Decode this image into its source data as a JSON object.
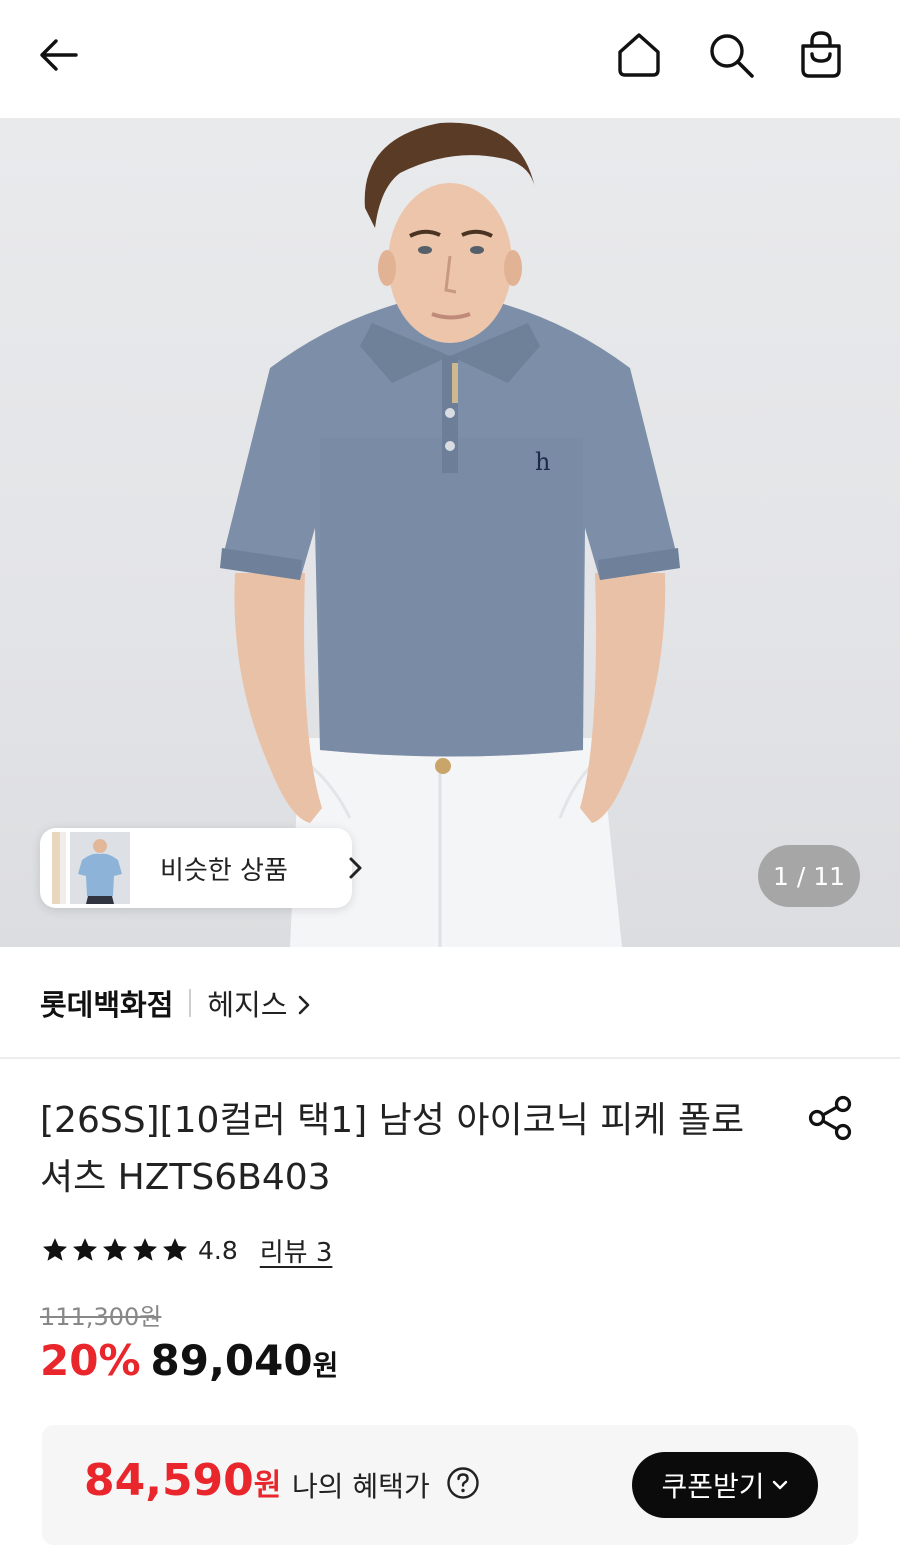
{
  "header": {
    "back_icon": "arrow-left-icon",
    "home_icon": "home-icon",
    "search_icon": "search-icon",
    "bag_icon": "shopping-bag-icon"
  },
  "gallery": {
    "current": "1",
    "total": "11",
    "counter_text": "1 / 11",
    "similar_label": "비슷한 상품"
  },
  "store": {
    "name": "롯데백화점",
    "brand": "헤지스"
  },
  "product": {
    "title": "[26SS][10컬러 택1] 남성 아이코닉 피케 폴로셔츠 HZTS6B403",
    "rating": "4.8",
    "rating_stars": 5,
    "review_text": "리뷰 3",
    "original_price": "111,300원",
    "discount": "20%",
    "sale_price": "89,040",
    "sale_unit": "원"
  },
  "benefit": {
    "price": "84,590",
    "unit": "원",
    "label": "나의 혜택가",
    "coupon_button": "쿠폰받기"
  },
  "colors": {
    "accent_red": "#e8262c",
    "coupon_bg": "#0b0b0b",
    "shirt_blue": "#7d8fa8"
  }
}
